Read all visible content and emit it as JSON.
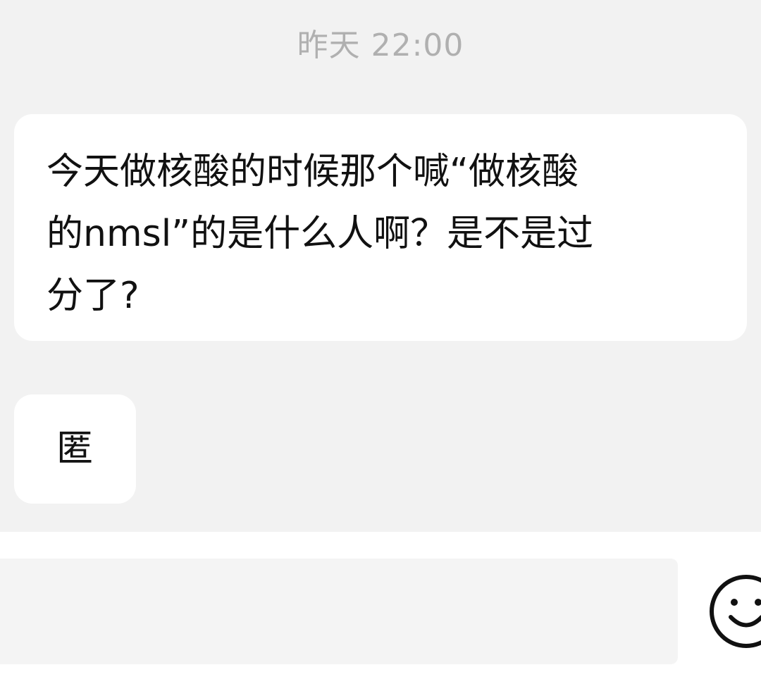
{
  "header": {
    "timestamp": "昨天 22:00"
  },
  "messages": [
    {
      "text": "今天做核酸的时候那个喊“做核酸\n的nmsl”的是什么人啊？是不是过\n分了?"
    },
    {
      "text": "匿"
    }
  ],
  "input": {
    "value": "",
    "emoji_icon": "smiley-face-icon"
  },
  "colors": {
    "background": "#f2f2f2",
    "bubble": "#ffffff",
    "timestamp": "#b0b0b0",
    "text": "#111111",
    "input_bg": "#f4f4f4"
  }
}
